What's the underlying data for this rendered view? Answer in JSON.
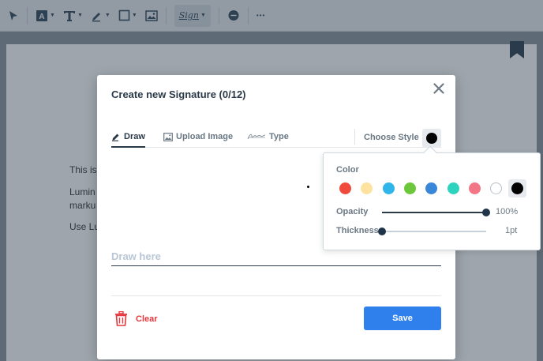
{
  "toolbar": {
    "items": [
      {
        "name": "select-tool",
        "icon": "cursor-arrow-icon"
      },
      {
        "name": "highlight-tool",
        "icon": "text-highlight-icon"
      },
      {
        "name": "text-tool",
        "icon": "text-T-icon"
      },
      {
        "name": "freehand-tool",
        "icon": "pen-icon"
      },
      {
        "name": "shape-tool",
        "icon": "square-icon"
      },
      {
        "name": "image-tool",
        "icon": "image-icon"
      },
      {
        "name": "signature-tool",
        "icon": "signature-icon",
        "glyph": "Sign"
      },
      {
        "name": "comment-tool",
        "icon": "comment-icon"
      },
      {
        "name": "more-tool",
        "icon": "more-dots-icon",
        "glyph": "•••"
      }
    ]
  },
  "document": {
    "lines": [
      "This is",
      "Lumin",
      "marku",
      "Use Lu"
    ]
  },
  "modal": {
    "title": "Create new Signature (0/12)",
    "close_glyph": "✕",
    "tabs": [
      {
        "label": "Draw",
        "icon": "pen-icon",
        "active": true
      },
      {
        "label": "Upload Image",
        "icon": "image-icon",
        "active": false
      },
      {
        "label": "Type",
        "icon": "signature-icon",
        "active": false
      }
    ],
    "choose_style_label": "Choose Style",
    "draw_placeholder": "Draw here",
    "clear_label": "Clear",
    "save_label": "Save"
  },
  "style_popover": {
    "color_label": "Color",
    "colors": [
      "#f04a3c",
      "#fde2a0",
      "#2fb5ea",
      "#6cc83a",
      "#3a86d8",
      "#2ed3c0",
      "#f27685",
      "#ffffff",
      "#000000"
    ],
    "selected_color": "#000000",
    "opacity_label": "Opacity",
    "opacity_value": "100%",
    "opacity_level": 1.0,
    "thickness_label": "Thickness",
    "thickness_value": "1pt",
    "thickness_level": 0.0
  },
  "colors": {
    "accent": "#2f80ed",
    "danger": "#e5373c",
    "text_dark": "#2b3a48"
  }
}
